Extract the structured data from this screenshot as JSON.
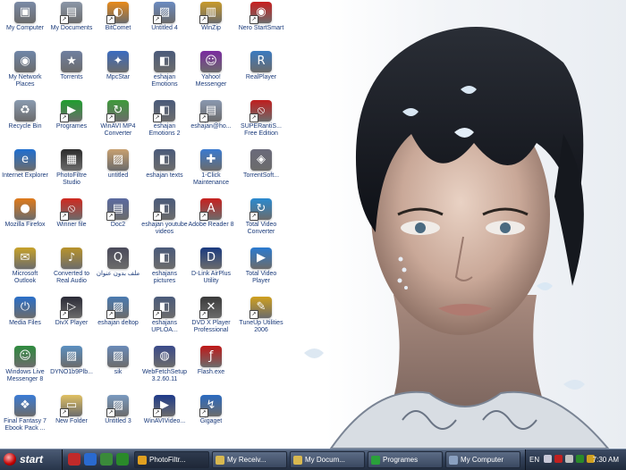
{
  "desktop": {
    "icons": [
      {
        "label": "My Computer",
        "icon": "computer-icon",
        "color": "#7a8aa6",
        "glyph": "▣"
      },
      {
        "label": "My Network Places",
        "icon": "network-icon",
        "color": "#6f86a8",
        "glyph": "◉"
      },
      {
        "label": "Recycle Bin",
        "icon": "recycle-bin-icon",
        "color": "#8a9bb0",
        "glyph": "♻"
      },
      {
        "label": "Internet Explorer",
        "icon": "internet-explorer-icon",
        "color": "#1f6fd1",
        "glyph": "e"
      },
      {
        "label": "Mozilla Firefox",
        "icon": "firefox-icon",
        "color": "#e07a1a",
        "glyph": "●"
      },
      {
        "label": "Microsoft Outlook",
        "icon": "outlook-icon",
        "color": "#c7a22a",
        "glyph": "✉"
      },
      {
        "label": "Media Files",
        "icon": "power-icon",
        "color": "#2a6fc9",
        "glyph": "⏻"
      },
      {
        "label": "Windows Live Messenger 8",
        "icon": "messenger-icon",
        "color": "#2e8b3e",
        "glyph": "☺"
      },
      {
        "label": "Final Fantasy 7 Ebook Pack ...",
        "icon": "shortcut-icon",
        "color": "#3a7bd5",
        "glyph": "❖"
      },
      {
        "label": "My Documents",
        "icon": "documents-icon",
        "color": "#8b97a8",
        "glyph": "▤"
      },
      {
        "label": "Torrents",
        "icon": "star-icon",
        "color": "#6f7fa0",
        "glyph": "★"
      },
      {
        "label": "Programes",
        "icon": "play-icon",
        "color": "#1f9e2e",
        "glyph": "▶"
      },
      {
        "label": "PhotoFiltre Studio",
        "icon": "photofiltre-icon",
        "color": "#2b2b2b",
        "glyph": "▦"
      },
      {
        "label": "Winner file",
        "icon": "no-entry-icon",
        "color": "#d0281e",
        "glyph": "⦸"
      },
      {
        "label": "Converted to Real Audio",
        "icon": "real-audio-icon",
        "color": "#b8932a",
        "glyph": "♪"
      },
      {
        "label": "DivX Player",
        "icon": "divx-icon",
        "color": "#2a2a36",
        "glyph": "▷"
      },
      {
        "label": "DYNO1b9Plb...",
        "icon": "image-icon",
        "color": "#5a8fc0",
        "glyph": "▨"
      },
      {
        "label": "New Folder",
        "icon": "folder-icon",
        "color": "#e0c062",
        "glyph": "▭"
      },
      {
        "label": "BitComet",
        "icon": "bitcomet-icon",
        "color": "#e88a1a",
        "glyph": "◐"
      },
      {
        "label": "MpcStar",
        "icon": "mpcstar-icon",
        "color": "#3a6bc0",
        "glyph": "✦"
      },
      {
        "label": "WinAVI MP4 Converter",
        "icon": "converter-icon",
        "color": "#3e9a3a",
        "glyph": "↻"
      },
      {
        "label": "untitled",
        "icon": "image-icon",
        "color": "#c8a070",
        "glyph": "▨"
      },
      {
        "label": "Doc2",
        "icon": "document-icon",
        "color": "#5a6aa0",
        "glyph": "▤"
      },
      {
        "label": "ملف بدون عنوان",
        "icon": "quicktime-icon",
        "color": "#4a4a5a",
        "glyph": "Q"
      },
      {
        "label": "eshajan deltop",
        "icon": "image-icon",
        "color": "#4a7ab0",
        "glyph": "▨"
      },
      {
        "label": "sik",
        "icon": "image-icon",
        "color": "#6a8ab8",
        "glyph": "▨"
      },
      {
        "label": "Untitled 3",
        "icon": "image-icon",
        "color": "#7a9ac0",
        "glyph": "▨"
      },
      {
        "label": "Untitled 4",
        "icon": "image-icon",
        "color": "#6a8ac0",
        "glyph": "▨"
      },
      {
        "label": "eshajan Emotions",
        "icon": "video-icon",
        "color": "#4a5a7a",
        "glyph": "◧"
      },
      {
        "label": "eshajan Emotions 2",
        "icon": "video-icon",
        "color": "#4a5a7a",
        "glyph": "◧"
      },
      {
        "label": "eshajan texts",
        "icon": "video-icon",
        "color": "#4a5a7a",
        "glyph": "◧"
      },
      {
        "label": "eshajan youtube videos",
        "icon": "video-icon",
        "color": "#4a5a7a",
        "glyph": "◧"
      },
      {
        "label": "eshajans pictures",
        "icon": "video-icon",
        "color": "#4a5a7a",
        "glyph": "◧"
      },
      {
        "label": "eshajans UPLOA...",
        "icon": "video-icon",
        "color": "#4a5a7a",
        "glyph": "◧"
      },
      {
        "label": "WebFetchSetup 3.2.60.11",
        "icon": "webfetch-icon",
        "color": "#3a4a8a",
        "glyph": "◍"
      },
      {
        "label": "WinAVIVideo...",
        "icon": "winavi-icon",
        "color": "#1e3a8a",
        "glyph": "▶"
      },
      {
        "label": "WinZip",
        "icon": "winzip-icon",
        "color": "#c89a2a",
        "glyph": "▥"
      },
      {
        "label": "Yahoo! Messenger",
        "icon": "yahoo-messenger-icon",
        "color": "#7a2aa0",
        "glyph": "☺"
      },
      {
        "label": "eshajan@ho...",
        "icon": "file-icon",
        "color": "#8a98b0",
        "glyph": "▤"
      },
      {
        "label": "1-Click Maintenance",
        "icon": "maintenance-icon",
        "color": "#3a7ad0",
        "glyph": "✚"
      },
      {
        "label": "Adobe Reader 8",
        "icon": "adobe-reader-icon",
        "color": "#c8201e",
        "glyph": "A"
      },
      {
        "label": "D-Link AirPlus Utility",
        "icon": "dlink-icon",
        "color": "#1a3a80",
        "glyph": "D"
      },
      {
        "label": "DVD X Player Professional",
        "icon": "dvd-player-icon",
        "color": "#3a3a3a",
        "glyph": "✕"
      },
      {
        "label": "Flash.exe",
        "icon": "flash-icon",
        "color": "#c01818",
        "glyph": "ƒ"
      },
      {
        "label": "Gigaget",
        "icon": "gigaget-icon",
        "color": "#2a6ac0",
        "glyph": "↯"
      },
      {
        "label": "Nero StartSmart",
        "icon": "nero-icon",
        "color": "#c81e1e",
        "glyph": "◉"
      },
      {
        "label": "RealPlayer",
        "icon": "realplayer-icon",
        "color": "#3a7ac0",
        "glyph": "R"
      },
      {
        "label": "SUPERantiS... Free Edition",
        "icon": "superantispyware-icon",
        "color": "#c01e1e",
        "glyph": "⦸"
      },
      {
        "label": "TorrentSoft...",
        "icon": "torrentsoft-icon",
        "color": "#6a6a7a",
        "glyph": "◈"
      },
      {
        "label": "Total Video Converter",
        "icon": "video-converter-icon",
        "color": "#2a8ad0",
        "glyph": "↻"
      },
      {
        "label": "Total Video Player",
        "icon": "video-player-icon",
        "color": "#2a7ad0",
        "glyph": "▶"
      },
      {
        "label": "TuneUp Utilities 2006",
        "icon": "tuneup-icon",
        "color": "#d0a01e",
        "glyph": "✎"
      }
    ]
  },
  "taskbar": {
    "start_label": "start",
    "quick_launch": [
      {
        "icon": "media-player-icon",
        "color": "#c02a2a"
      },
      {
        "icon": "internet-explorer-icon",
        "color": "#2a6ad0"
      },
      {
        "icon": "show-desktop-icon",
        "color": "#3a8a3a"
      },
      {
        "icon": "excel-icon",
        "color": "#2a8a2a"
      }
    ],
    "tasks": [
      {
        "label": "PhotoFiltr...",
        "icon": "photofiltre-icon",
        "color": "#e0a020",
        "active": true
      },
      {
        "label": "My Receiv...",
        "icon": "folder-icon",
        "color": "#d8b850",
        "active": false
      },
      {
        "label": "My Docum...",
        "icon": "folder-icon",
        "color": "#d8b850",
        "active": false
      },
      {
        "label": "Programes",
        "icon": "play-icon",
        "color": "#2aa03a",
        "active": false
      },
      {
        "label": "My Computer",
        "icon": "computer-icon",
        "color": "#8aa0c0",
        "active": false
      }
    ],
    "tray": {
      "language": "EN",
      "icons": [
        {
          "icon": "network-tray-icon",
          "color": "#c8c8d8"
        },
        {
          "icon": "antivirus-tray-icon",
          "color": "#c02020"
        },
        {
          "icon": "volume-tray-icon",
          "color": "#c0c0c0"
        },
        {
          "icon": "messenger-tray-icon",
          "color": "#2a8a2a"
        },
        {
          "icon": "shield-tray-icon",
          "color": "#d0a020"
        }
      ],
      "clock": "7:30 AM"
    }
  }
}
